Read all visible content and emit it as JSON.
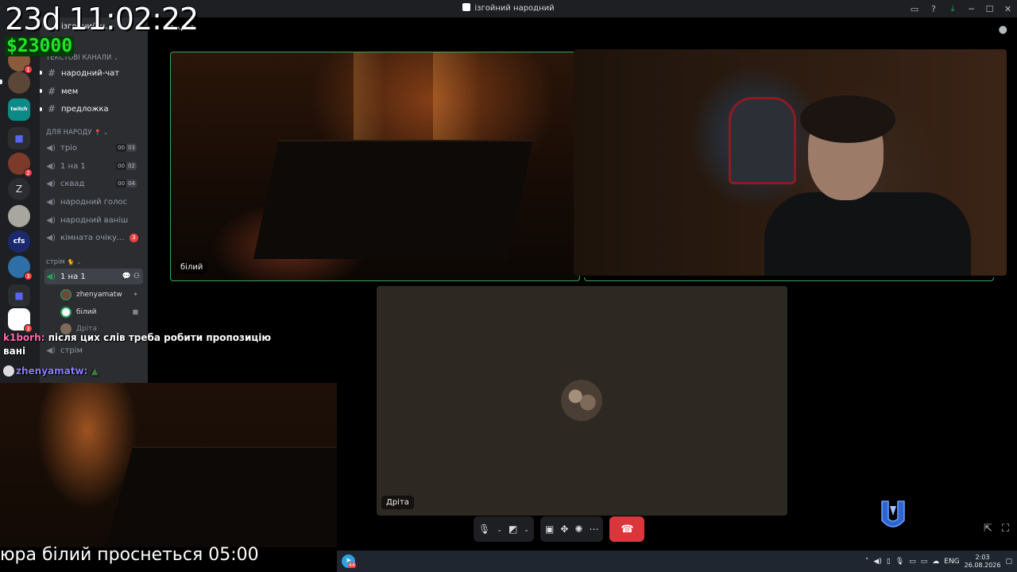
{
  "window": {
    "title": "ізгойний народний"
  },
  "server": {
    "name": "ізгойний н..."
  },
  "categories": {
    "text": "ТЕКСТОВІ КАНАЛИ",
    "voice": "ДЛЯ НАРОДУ",
    "stream": "стрім"
  },
  "text_channels": [
    {
      "label": "народний-чат"
    },
    {
      "label": "мем"
    },
    {
      "label": "предложка"
    }
  ],
  "voice_channels": [
    {
      "label": "тріо",
      "count": "00",
      "limit": "03"
    },
    {
      "label": "1 на 1",
      "count": "00",
      "limit": "02"
    },
    {
      "label": "сквад",
      "count": "00",
      "limit": "04"
    },
    {
      "label": "народний голос"
    },
    {
      "label": "народний ваніш"
    },
    {
      "label": "кімната очіку...",
      "badge": "3"
    }
  ],
  "stream_channels": [
    {
      "label": "1 на 1"
    },
    {
      "label": "стрім"
    }
  ],
  "members": [
    {
      "name": "zhenyamatw"
    },
    {
      "name": "білий"
    },
    {
      "name": "Дріта"
    }
  ],
  "rail": {
    "badges": [
      "1",
      "2",
      "3",
      "3"
    ],
    "letter": "Z",
    "twitch": "twitch",
    "cfs": "cfs"
  },
  "call": {
    "header": "1 на 1",
    "tiles": [
      {
        "name": "білий"
      },
      {
        "name": "Дріта"
      }
    ]
  },
  "overlay": {
    "timer": "23d 11:02:22",
    "money": "$23000",
    "chat": [
      {
        "user": "k1borh:",
        "text": "після цих слів треба робити пропозицію"
      },
      {
        "user": "",
        "text": "вані"
      },
      {
        "user": "zhenyamatw:",
        "text": ""
      }
    ],
    "ticker": "юра білий проснеться 05:00"
  },
  "taskbar": {
    "tg_badge": "44",
    "lang": "ENG",
    "time": "2:03",
    "date": "26.08.2026"
  },
  "colors": {
    "accent_green": "#3ba55d",
    "hangup_red": "#da373c",
    "money_green": "#20e626",
    "chat_user1": "#ff6ab0",
    "chat_user2": "#8a7cff"
  }
}
